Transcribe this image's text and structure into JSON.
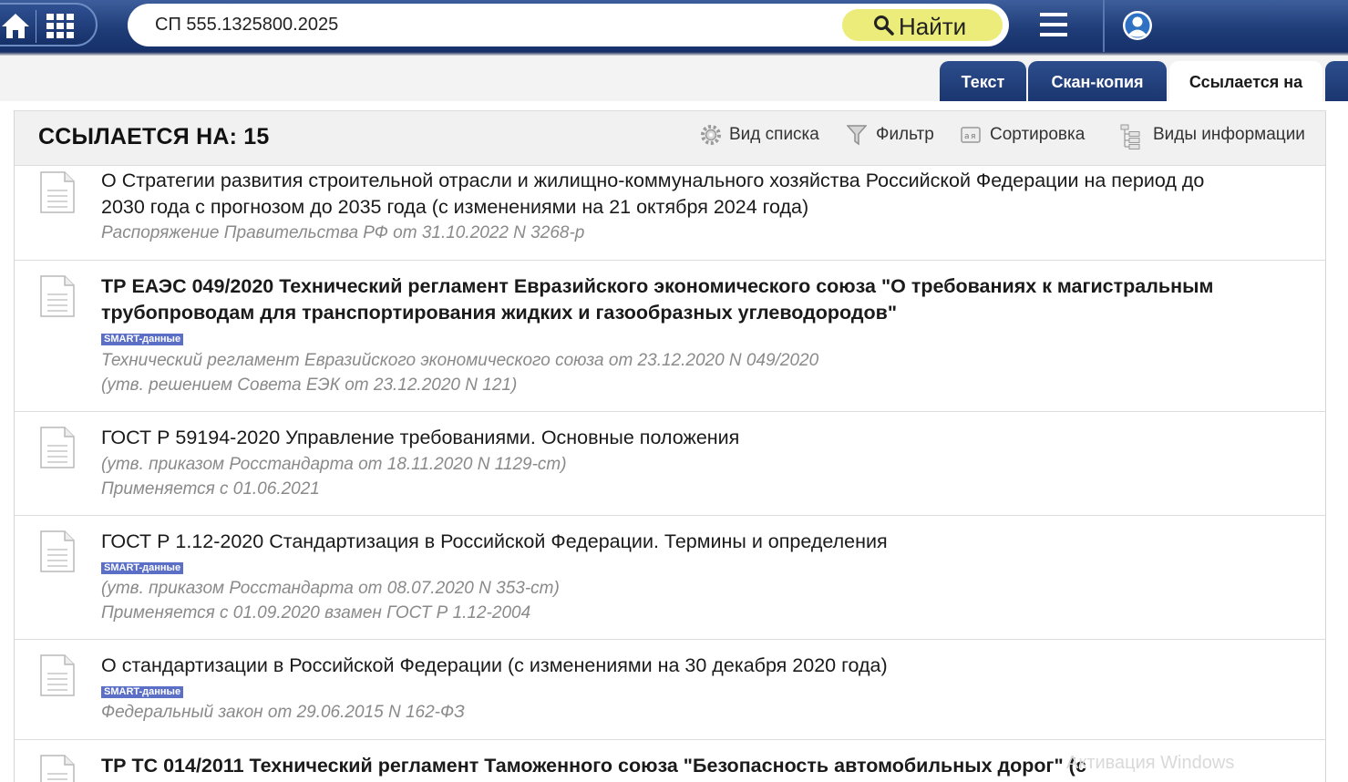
{
  "header": {
    "search": {
      "value": "СП 555.1325800.2025"
    },
    "search_button_label": "Найти",
    "colors": {
      "bar": "#1f3d78",
      "search_button": "#ecec7a"
    }
  },
  "tabs": [
    {
      "label": "Текст",
      "active": false
    },
    {
      "label": "Скан-копия",
      "active": false
    },
    {
      "label": "Ссылается на",
      "active": true
    }
  ],
  "panel": {
    "title": "ССЫЛАЕТСЯ НА: 15",
    "tools": {
      "list_view": "Вид списка",
      "filter": "Фильтр",
      "sort": "Сортировка",
      "info_types": "Виды информации"
    }
  },
  "smart_badge": "SMART-данные",
  "documents": [
    {
      "title": "О Стратегии развития строительной отрасли и жилищно-коммунального хозяйства Российской Федерации на период до 2030 года с прогнозом до 2035 года (с изменениями на 21 октября 2024 года)",
      "bold": false,
      "smart": false,
      "meta": [
        "Распоряжение Правительства РФ от 31.10.2022 N 3268-р"
      ]
    },
    {
      "title": "ТР ЕАЭС 049/2020 Технический регламент Евразийского экономического союза \"О требованиях к магистральным трубопроводам для транспортирования жидких и газообразных углеводородов\"",
      "bold": true,
      "smart": true,
      "meta": [
        "Технический регламент Евразийского экономического союза от 23.12.2020 N 049/2020",
        "(утв. решением Совета ЕЭК от 23.12.2020 N 121)"
      ]
    },
    {
      "title": "ГОСТ Р 59194-2020 Управление требованиями. Основные положения",
      "bold": false,
      "smart": false,
      "meta": [
        "(утв. приказом Росстандарта от 18.11.2020 N 1129-ст)",
        "Применяется с 01.06.2021"
      ]
    },
    {
      "title": "ГОСТ Р 1.12-2020 Стандартизация в Российской Федерации. Термины и определения",
      "bold": false,
      "smart": true,
      "meta": [
        "(утв. приказом Росстандарта от 08.07.2020 N 353-ст)",
        "Применяется с 01.09.2020 взамен ГОСТ Р 1.12-2004"
      ]
    },
    {
      "title": "О стандартизации в Российской Федерации (с изменениями на 30 декабря 2020 года)",
      "bold": false,
      "smart": true,
      "meta": [
        "Федеральный закон от 29.06.2015 N 162-ФЗ"
      ]
    },
    {
      "title": "ТР ТС 014/2011 Технический регламент Таможенного союза \"Безопасность автомобильных дорог\" (с",
      "bold": true,
      "smart": false,
      "meta": []
    }
  ],
  "watermark": "Активация Windows"
}
